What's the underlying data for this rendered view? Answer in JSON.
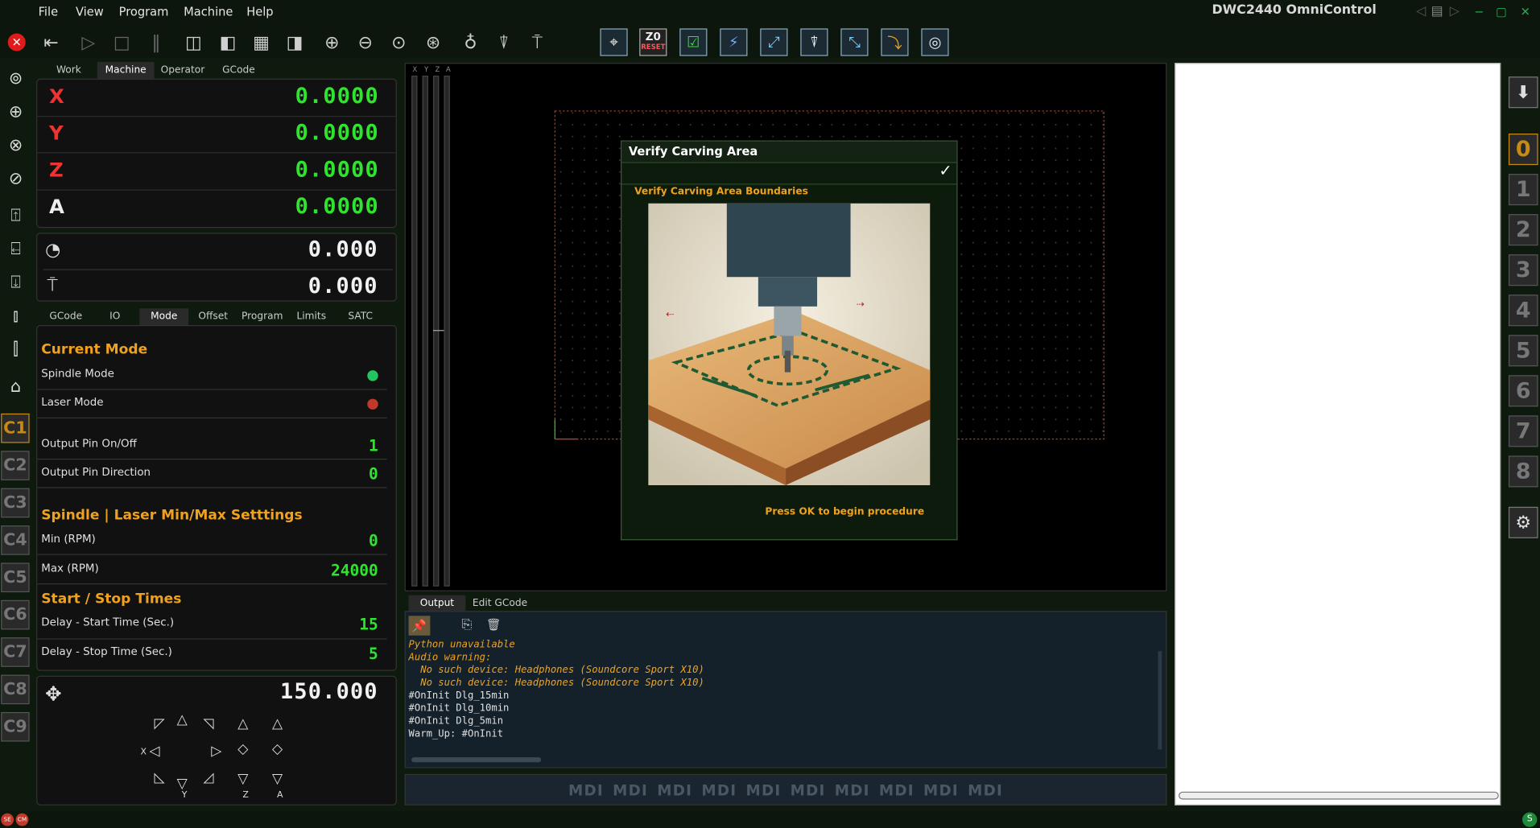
{
  "app_title": "DWC2440 OmniControl",
  "menu": [
    "File",
    "View",
    "Program",
    "Machine",
    "Help"
  ],
  "toolbar": {
    "z0_top": "Z0",
    "z0_bottom": "RESET"
  },
  "dro_tabs": [
    "Work",
    "Machine",
    "Operator",
    "GCode"
  ],
  "dro_active_tab": "Machine",
  "axes": [
    {
      "label": "X",
      "value": "0.0000"
    },
    {
      "label": "Y",
      "value": "0.0000"
    },
    {
      "label": "Z",
      "value": "0.0000"
    },
    {
      "label": "A",
      "value": "0.0000"
    }
  ],
  "feed_value": "0.000",
  "spindle_value": "0.000",
  "mode_tabs": [
    "GCode",
    "IO",
    "Mode",
    "Offset",
    "Program",
    "Limits",
    "SATC"
  ],
  "mode_active_tab": "Mode",
  "mode": {
    "current_mode_title": "Current Mode",
    "spindle_mode_label": "Spindle Mode",
    "spindle_mode_led_color": "#22c55e",
    "laser_mode_label": "Laser Mode",
    "laser_mode_led_color": "#c0392b",
    "output_on_off_label": "Output Pin On/Off",
    "output_on_off_value": "1",
    "output_dir_label": "Output Pin Direction",
    "output_dir_value": "0",
    "minmax_title": "Spindle | Laser Min/Max Setttings",
    "min_label": "Min (RPM)",
    "min_value": "0",
    "max_label": "Max (RPM)",
    "max_value": "24000",
    "times_title": "Start / Stop Times",
    "start_label": "Delay - Start Time (Sec.)",
    "start_value": "15",
    "stop_label": "Delay - Stop Time (Sec.)",
    "stop_value": "5"
  },
  "jog": {
    "step_value": "150.000",
    "x_label": "X",
    "y_label": "Y",
    "z_label": "Z",
    "a_label": "A"
  },
  "c_buttons": [
    "C1",
    "C2",
    "C3",
    "C4",
    "C5",
    "C6",
    "C7",
    "C8",
    "C9"
  ],
  "c_active": "C1",
  "bar_labels": [
    "X",
    "Y",
    "Z",
    "A"
  ],
  "dialog": {
    "title": "Verify Carving Area",
    "subtitle": "Verify Carving Area Boundaries",
    "footer": "Press OK to begin procedure"
  },
  "console_tabs": [
    "Output",
    "Edit GCode"
  ],
  "console_lines": [
    {
      "text": "Python unavailable",
      "color": "#f0a21c",
      "italic": true
    },
    {
      "text": "Audio warning:",
      "color": "#f0a21c",
      "italic": true
    },
    {
      "text": "  No such device: Headphones (Soundcore Sport X10)",
      "color": "#f0a21c",
      "italic": true
    },
    {
      "text": "  No such device: Headphones (Soundcore Sport X10)",
      "color": "#f0a21c",
      "italic": true
    },
    {
      "text": "#OnInit Dlg_15min",
      "color": "#e0e0e0",
      "italic": false
    },
    {
      "text": "#OnInit Dlg_10min",
      "color": "#e0e0e0",
      "italic": false
    },
    {
      "text": "#OnInit Dlg_5min",
      "color": "#e0e0e0",
      "italic": false
    },
    {
      "text": "Warm_Up: #OnInit",
      "color": "#e0e0e0",
      "italic": false
    }
  ],
  "mdi_placeholder": "MDI MDI MDI MDI MDI MDI MDI MDI MDI MDI",
  "number_buttons": [
    "0",
    "1",
    "2",
    "3",
    "4",
    "5",
    "6",
    "7",
    "8"
  ],
  "number_active": "0",
  "status_left": [
    "SE",
    "CM"
  ]
}
